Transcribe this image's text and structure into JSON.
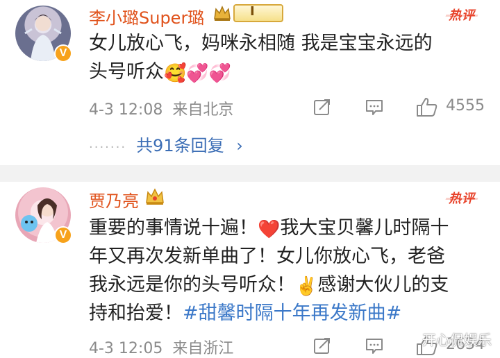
{
  "comments": [
    {
      "username": "李小璐Super璐",
      "hot_label": "热评",
      "text_lines": [
        "女儿放心飞，妈咪永相随 我是宝宝永远的",
        "头号听众"
      ],
      "emojis": "🥰💞💞",
      "date": "4-3 12:08",
      "source": "来自北京",
      "likes": "4555",
      "replies_label": "共91条回复",
      "vip_label": "I"
    },
    {
      "username": "贾乃亮",
      "hot_label": "热评",
      "line1_a": "重要的事情说十遍！",
      "emoji_heart": "❤️",
      "line1_b": "我大宝贝馨儿时隔十",
      "line2": "年又再次发新单曲了！女儿你放心飞，老爸",
      "line3_a": "我永远是你的头号听众！",
      "emoji_victory": "✌️",
      "line3_b": "感谢大伙儿的支",
      "line4_a": "持和抬爱！",
      "hashtag": "#甜馨时隔十年再发新曲#",
      "date": "4-3 12:05",
      "source": "来自浙江",
      "likes": "2634"
    }
  ],
  "watermark": "开心侃娱乐",
  "colors": {
    "username": "#e0521b",
    "hot": "#e8432b",
    "link": "#3b78c8",
    "meta": "#8a8a8a"
  },
  "icons": [
    "share-icon",
    "comment-icon",
    "like-icon",
    "chevron-right-icon",
    "verified-icon",
    "vip-crown-icon"
  ]
}
